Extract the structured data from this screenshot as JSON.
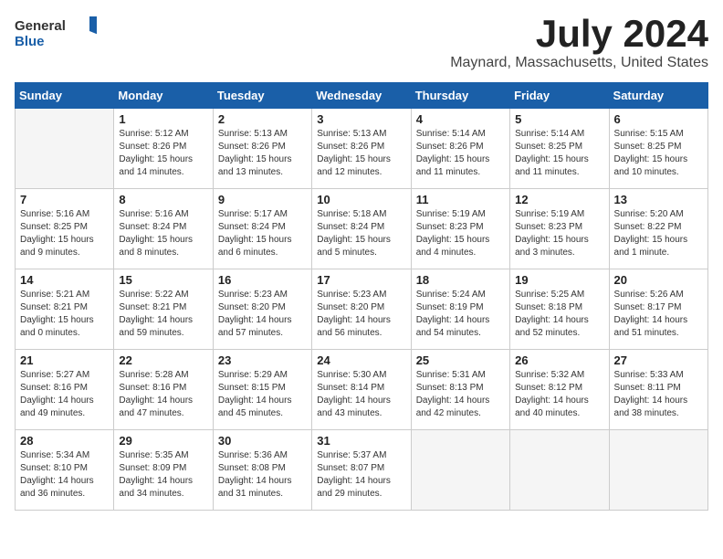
{
  "header": {
    "logo_general": "General",
    "logo_blue": "Blue",
    "month_title": "July 2024",
    "location": "Maynard, Massachusetts, United States"
  },
  "days_of_week": [
    "Sunday",
    "Monday",
    "Tuesday",
    "Wednesday",
    "Thursday",
    "Friday",
    "Saturday"
  ],
  "weeks": [
    [
      {
        "day": "",
        "empty": true
      },
      {
        "day": "1",
        "sunrise": "5:12 AM",
        "sunset": "8:26 PM",
        "daylight": "15 hours and 14 minutes."
      },
      {
        "day": "2",
        "sunrise": "5:13 AM",
        "sunset": "8:26 PM",
        "daylight": "15 hours and 13 minutes."
      },
      {
        "day": "3",
        "sunrise": "5:13 AM",
        "sunset": "8:26 PM",
        "daylight": "15 hours and 12 minutes."
      },
      {
        "day": "4",
        "sunrise": "5:14 AM",
        "sunset": "8:26 PM",
        "daylight": "15 hours and 11 minutes."
      },
      {
        "day": "5",
        "sunrise": "5:14 AM",
        "sunset": "8:25 PM",
        "daylight": "15 hours and 11 minutes."
      },
      {
        "day": "6",
        "sunrise": "5:15 AM",
        "sunset": "8:25 PM",
        "daylight": "15 hours and 10 minutes."
      }
    ],
    [
      {
        "day": "7",
        "sunrise": "5:16 AM",
        "sunset": "8:25 PM",
        "daylight": "15 hours and 9 minutes."
      },
      {
        "day": "8",
        "sunrise": "5:16 AM",
        "sunset": "8:24 PM",
        "daylight": "15 hours and 8 minutes."
      },
      {
        "day": "9",
        "sunrise": "5:17 AM",
        "sunset": "8:24 PM",
        "daylight": "15 hours and 6 minutes."
      },
      {
        "day": "10",
        "sunrise": "5:18 AM",
        "sunset": "8:24 PM",
        "daylight": "15 hours and 5 minutes."
      },
      {
        "day": "11",
        "sunrise": "5:19 AM",
        "sunset": "8:23 PM",
        "daylight": "15 hours and 4 minutes."
      },
      {
        "day": "12",
        "sunrise": "5:19 AM",
        "sunset": "8:23 PM",
        "daylight": "15 hours and 3 minutes."
      },
      {
        "day": "13",
        "sunrise": "5:20 AM",
        "sunset": "8:22 PM",
        "daylight": "15 hours and 1 minute."
      }
    ],
    [
      {
        "day": "14",
        "sunrise": "5:21 AM",
        "sunset": "8:21 PM",
        "daylight": "15 hours and 0 minutes."
      },
      {
        "day": "15",
        "sunrise": "5:22 AM",
        "sunset": "8:21 PM",
        "daylight": "14 hours and 59 minutes."
      },
      {
        "day": "16",
        "sunrise": "5:23 AM",
        "sunset": "8:20 PM",
        "daylight": "14 hours and 57 minutes."
      },
      {
        "day": "17",
        "sunrise": "5:23 AM",
        "sunset": "8:20 PM",
        "daylight": "14 hours and 56 minutes."
      },
      {
        "day": "18",
        "sunrise": "5:24 AM",
        "sunset": "8:19 PM",
        "daylight": "14 hours and 54 minutes."
      },
      {
        "day": "19",
        "sunrise": "5:25 AM",
        "sunset": "8:18 PM",
        "daylight": "14 hours and 52 minutes."
      },
      {
        "day": "20",
        "sunrise": "5:26 AM",
        "sunset": "8:17 PM",
        "daylight": "14 hours and 51 minutes."
      }
    ],
    [
      {
        "day": "21",
        "sunrise": "5:27 AM",
        "sunset": "8:16 PM",
        "daylight": "14 hours and 49 minutes."
      },
      {
        "day": "22",
        "sunrise": "5:28 AM",
        "sunset": "8:16 PM",
        "daylight": "14 hours and 47 minutes."
      },
      {
        "day": "23",
        "sunrise": "5:29 AM",
        "sunset": "8:15 PM",
        "daylight": "14 hours and 45 minutes."
      },
      {
        "day": "24",
        "sunrise": "5:30 AM",
        "sunset": "8:14 PM",
        "daylight": "14 hours and 43 minutes."
      },
      {
        "day": "25",
        "sunrise": "5:31 AM",
        "sunset": "8:13 PM",
        "daylight": "14 hours and 42 minutes."
      },
      {
        "day": "26",
        "sunrise": "5:32 AM",
        "sunset": "8:12 PM",
        "daylight": "14 hours and 40 minutes."
      },
      {
        "day": "27",
        "sunrise": "5:33 AM",
        "sunset": "8:11 PM",
        "daylight": "14 hours and 38 minutes."
      }
    ],
    [
      {
        "day": "28",
        "sunrise": "5:34 AM",
        "sunset": "8:10 PM",
        "daylight": "14 hours and 36 minutes."
      },
      {
        "day": "29",
        "sunrise": "5:35 AM",
        "sunset": "8:09 PM",
        "daylight": "14 hours and 34 minutes."
      },
      {
        "day": "30",
        "sunrise": "5:36 AM",
        "sunset": "8:08 PM",
        "daylight": "14 hours and 31 minutes."
      },
      {
        "day": "31",
        "sunrise": "5:37 AM",
        "sunset": "8:07 PM",
        "daylight": "14 hours and 29 minutes."
      },
      {
        "day": "",
        "empty": true
      },
      {
        "day": "",
        "empty": true
      },
      {
        "day": "",
        "empty": true
      }
    ]
  ],
  "labels": {
    "sunrise": "Sunrise:",
    "sunset": "Sunset:",
    "daylight": "Daylight:"
  }
}
